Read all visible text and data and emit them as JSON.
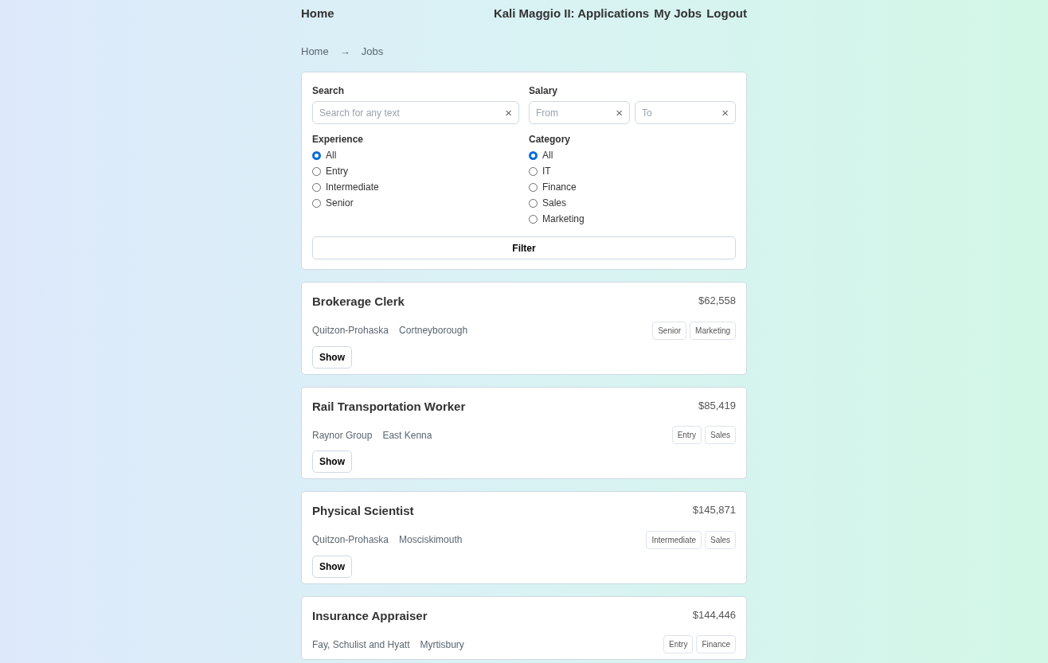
{
  "nav": {
    "home": "Home",
    "links": [
      "Kali Maggio II: Applications",
      "My Jobs",
      "Logout"
    ]
  },
  "breadcrumb": {
    "items": [
      "Home",
      "Jobs"
    ],
    "separator": "→"
  },
  "filters": {
    "search": {
      "label": "Search",
      "placeholder": "Search for any text",
      "clear": "×"
    },
    "salary": {
      "label": "Salary",
      "fields": [
        {
          "placeholder": "From",
          "clear": "×"
        },
        {
          "placeholder": "To",
          "clear": "×"
        }
      ]
    },
    "experience": {
      "label": "Experience",
      "options": [
        {
          "label": "All",
          "selected": true
        },
        {
          "label": "Entry",
          "selected": false
        },
        {
          "label": "Intermediate",
          "selected": false
        },
        {
          "label": "Senior",
          "selected": false
        }
      ]
    },
    "category": {
      "label": "Category",
      "options": [
        {
          "label": "All",
          "selected": true
        },
        {
          "label": "IT",
          "selected": false
        },
        {
          "label": "Finance",
          "selected": false
        },
        {
          "label": "Sales",
          "selected": false
        },
        {
          "label": "Marketing",
          "selected": false
        }
      ]
    },
    "button": "Filter"
  },
  "jobs": [
    {
      "title": "Brokerage Clerk",
      "salary": "$62,558",
      "company": "Quitzon-Prohaska",
      "location": "Cortneyborough",
      "tags": [
        "Senior",
        "Marketing"
      ],
      "action": "Show"
    },
    {
      "title": "Rail Transportation Worker",
      "salary": "$85,419",
      "company": "Raynor Group",
      "location": "East Kenna",
      "tags": [
        "Entry",
        "Sales"
      ],
      "action": "Show"
    },
    {
      "title": "Physical Scientist",
      "salary": "$145,871",
      "company": "Quitzon-Prohaska",
      "location": "Mosciskimouth",
      "tags": [
        "Intermediate",
        "Sales"
      ],
      "action": "Show"
    },
    {
      "title": "Insurance Appraiser",
      "salary": "$144,446",
      "company": "Fay, Schulist and Hyatt",
      "location": "Myrtisbury",
      "tags": [
        "Entry",
        "Finance"
      ]
    }
  ]
}
